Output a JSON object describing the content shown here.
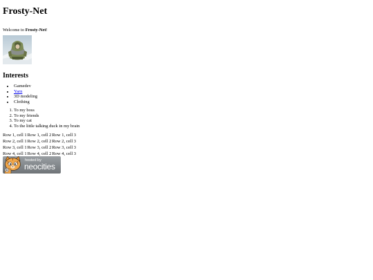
{
  "header": {
    "title": "Frosty-Net"
  },
  "intro": {
    "welcome_prefix": "Welcome to ",
    "welcome_site": "Frosty-Net",
    "welcome_suffix": "!"
  },
  "avatar": {
    "icon": "cloaked-figure-in-snow-image"
  },
  "interests": {
    "heading": "Interests",
    "items": [
      "Gamedev",
      "Yarn",
      "3D modeling",
      "Clothing"
    ],
    "linked_item_index": 1
  },
  "dedications": {
    "items": [
      "To my boss",
      "To my friends",
      "To my cat",
      "To the little talking duck in my brain"
    ]
  },
  "table": {
    "rows": [
      [
        "Row 1, cell 1",
        "Row 1, cell 2",
        "Row 1, cell 3"
      ],
      [
        "Row 2, cell 1",
        "Row 2, cell 2",
        "Row 2, cell 3"
      ],
      [
        "Row 3, cell 1",
        "Row 3, cell 2",
        "Row 3, cell 3"
      ],
      [
        "Row 4, cell 1",
        "Row 4, cell 2",
        "Row 4, cell 3"
      ]
    ]
  },
  "footer_badge": {
    "hosted_by": "hosted by",
    "name": "neocities",
    "icon": "neocities-cat-mascot-icon"
  },
  "colors": {
    "link": "#0000ee",
    "background": "#ffffff",
    "text": "#000000"
  }
}
